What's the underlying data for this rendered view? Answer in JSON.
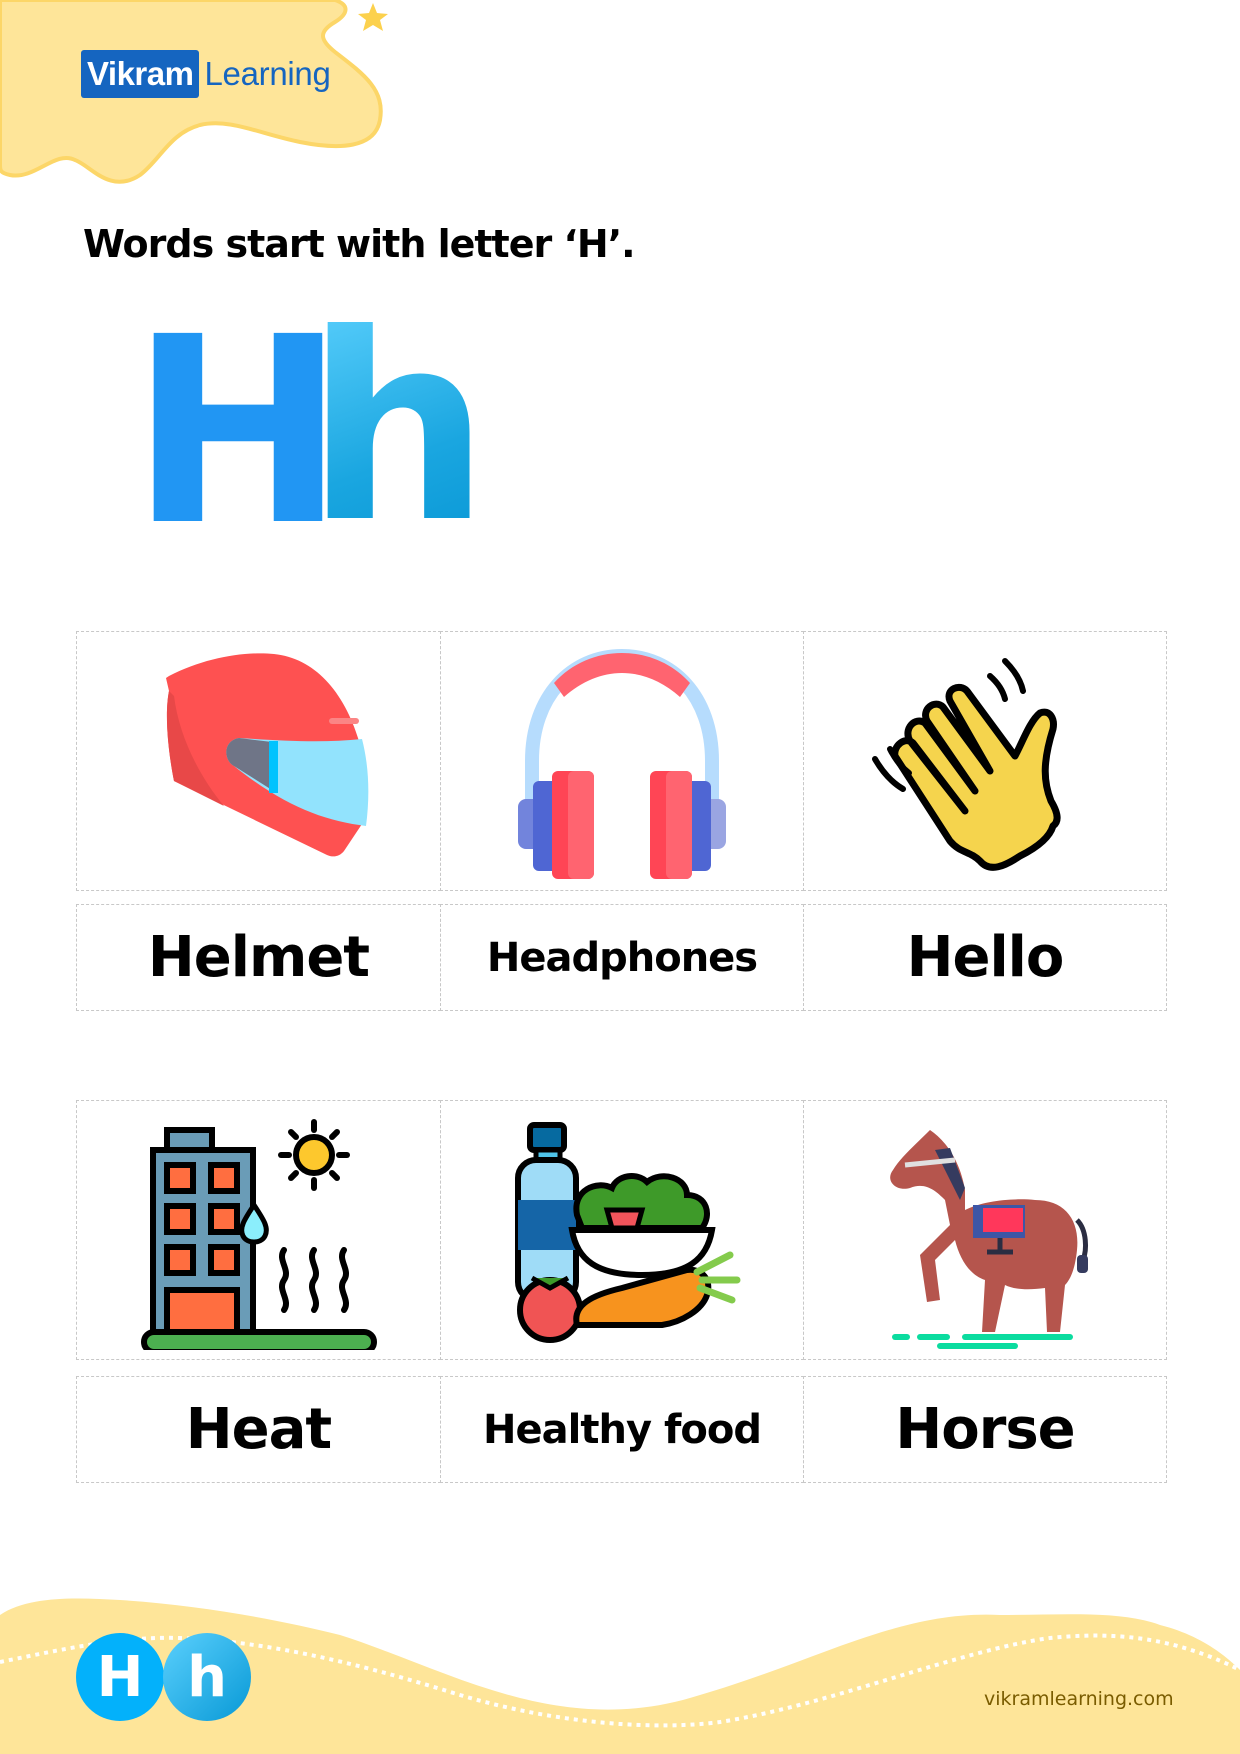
{
  "logo": {
    "part1": "Vikram",
    "part2": "Learning"
  },
  "title": "Words start with letter ‘H’.",
  "letters": {
    "upper": "H",
    "lower": "h"
  },
  "rows": [
    {
      "items": [
        {
          "word": "Helmet",
          "icon": "helmet-icon",
          "size": "big"
        },
        {
          "word": "Headphones",
          "icon": "headphones-icon",
          "size": "small"
        },
        {
          "word": "Hello",
          "icon": "waving-hand-icon",
          "size": "big"
        }
      ]
    },
    {
      "items": [
        {
          "word": "Heat",
          "icon": "heat-building-icon",
          "size": "big"
        },
        {
          "word": "Healthy food",
          "icon": "healthy-food-icon",
          "size": "small"
        },
        {
          "word": "Horse",
          "icon": "horse-icon",
          "size": "big"
        }
      ]
    }
  ],
  "footer": {
    "badge_upper": "H",
    "badge_lower": "h",
    "website": "vikramlearning.com"
  },
  "colors": {
    "brand_blue": "#1565c0",
    "letter_blue": "#2196f3",
    "blob_yellow": "#fee599"
  }
}
